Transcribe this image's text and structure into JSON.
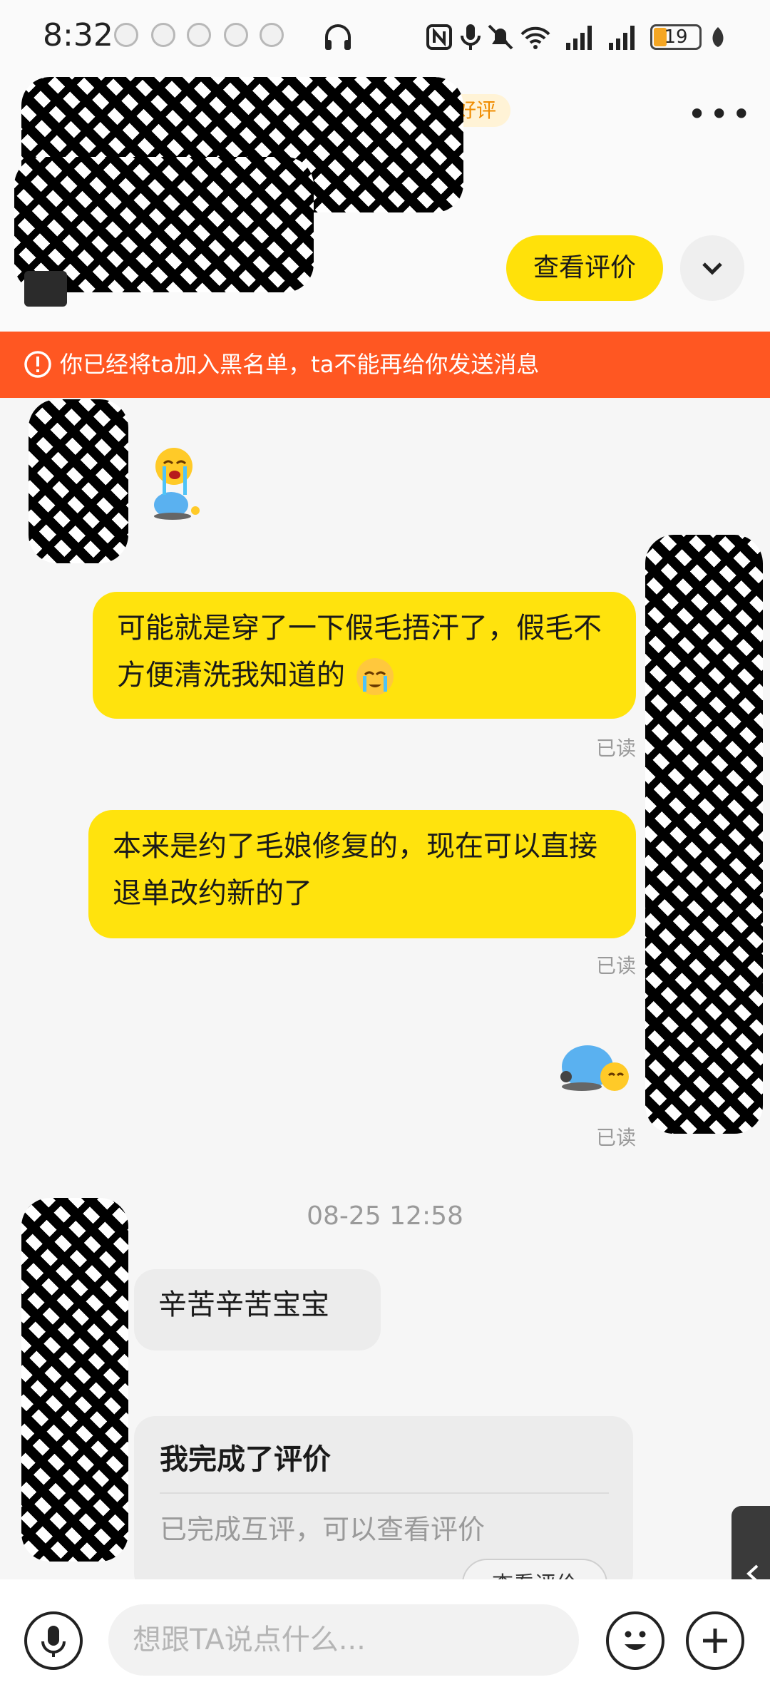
{
  "status_bar": {
    "time": "8:32",
    "battery": "19"
  },
  "header": {
    "rating_badge": "好评",
    "more_label": "•••",
    "view_review_label": "查看评价"
  },
  "banner": {
    "text": "你已经将ta加入黑名单，ta不能再给你发送消息"
  },
  "messages": {
    "m1": "可能就是穿了一下假毛捂汗了，假毛不方便清洗我知道的",
    "m1_read": "已读",
    "m2": "本来是约了毛娘修复的，现在可以直接退单改约新的了",
    "m2_read": "已读",
    "m3_read": "已读",
    "timestamp": "08-25 12:58",
    "m4": "辛苦辛苦宝宝"
  },
  "review_card": {
    "title": "我完成了评价",
    "subtitle": "已完成互评，可以查看评价",
    "button": "查看评价"
  },
  "input": {
    "placeholder": "想跟TA说点什么..."
  },
  "colors": {
    "accent_yellow": "#ffe30d",
    "banner_red": "#ff5722",
    "rating_orange": "#f08c00"
  },
  "icons": [
    "headphones-icon",
    "nfc-icon",
    "mic-icon",
    "mute-icon",
    "wifi-icon",
    "signal-icon",
    "battery-icon",
    "back-icon",
    "more-icon",
    "chevron-down-icon",
    "warning-icon",
    "crying-emoji-icon",
    "voice-icon",
    "emoji-icon",
    "plus-icon",
    "chevron-left-icon"
  ]
}
